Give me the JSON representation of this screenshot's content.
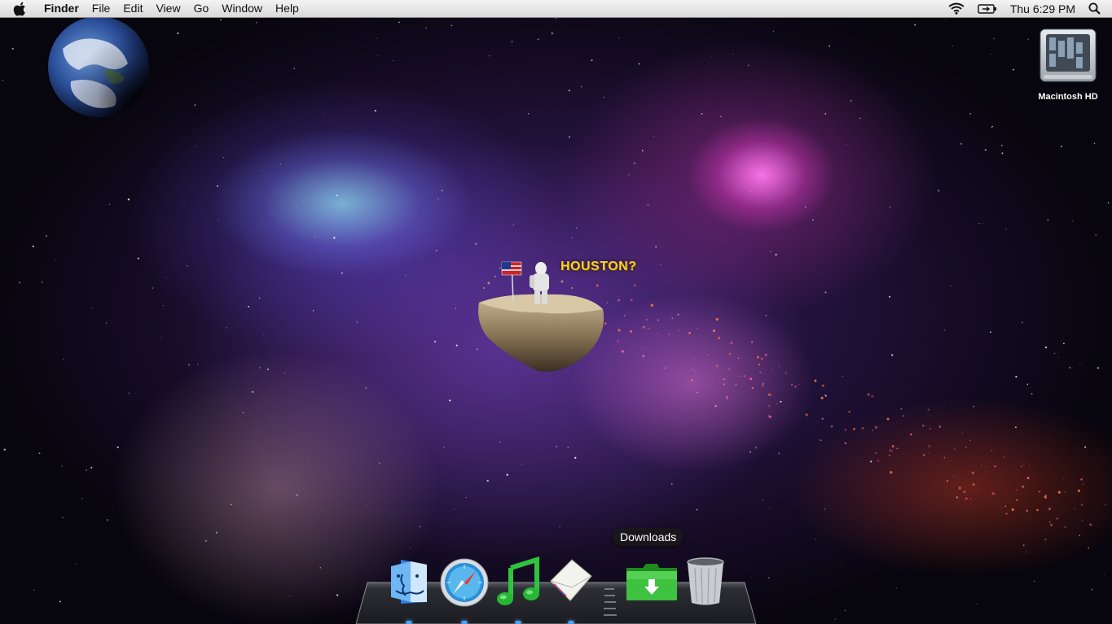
{
  "menubar": {
    "app_name": "Finder",
    "menus": [
      "File",
      "Edit",
      "View",
      "Go",
      "Window",
      "Help"
    ],
    "clock": "Thu 6:29 PM",
    "status_icons": [
      "wifi-icon",
      "battery-icon",
      "spotlight-icon"
    ]
  },
  "desktop": {
    "wallpaper_text": "HOUSTON?",
    "icons": [
      {
        "label": "Macintosh HD",
        "icon": "hard-drive-icon"
      }
    ]
  },
  "dock": {
    "tooltip": "Downloads",
    "items": [
      {
        "icon": "finder-icon",
        "running": true
      },
      {
        "icon": "safari-icon",
        "running": true
      },
      {
        "icon": "itunes-icon",
        "running": true
      },
      {
        "icon": "mail-icon",
        "running": true
      },
      {
        "icon": "downloads-folder-icon",
        "running": false
      },
      {
        "icon": "trash-icon",
        "running": false
      }
    ]
  },
  "colors": {
    "menubar_bg": "#e6e6e6",
    "houston_text": "#f8d22b",
    "nebula_pink": "#ff78f0",
    "nebula_cyan": "#8cdceb",
    "running_indicator": "#4aa3ff"
  }
}
